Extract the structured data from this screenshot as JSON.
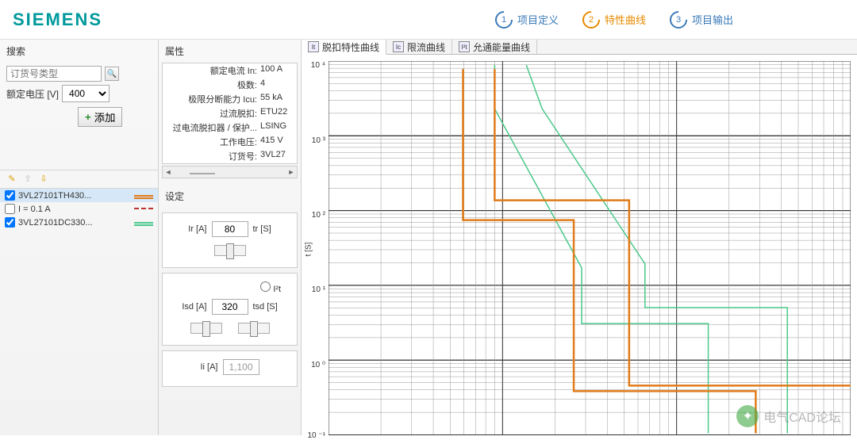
{
  "header": {
    "logo": "SIEMENS",
    "steps": [
      {
        "num": "1",
        "label": "项目定义"
      },
      {
        "num": "2",
        "label": "特性曲线"
      },
      {
        "num": "3",
        "label": "项目输出"
      }
    ],
    "active_step": 1
  },
  "search": {
    "title": "搜索",
    "placeholder": "订货号类型",
    "voltage_label": "额定电压 [V]",
    "voltage_value": "400",
    "add_label": "添加"
  },
  "items": [
    {
      "checked": true,
      "label": "3VL27101TH430...",
      "color": "orange"
    },
    {
      "checked": false,
      "label": "I = 0.1 A",
      "color": "dashed"
    },
    {
      "checked": true,
      "label": "3VL27101DC330...",
      "color": "green"
    }
  ],
  "props": {
    "title": "属性",
    "rows": [
      {
        "k": "额定电流 In:",
        "v": "100 A"
      },
      {
        "k": "极数:",
        "v": "4"
      },
      {
        "k": "极限分断能力 Icu:",
        "v": "55 kA"
      },
      {
        "k": "过流脱扣:",
        "v": "ETU22"
      },
      {
        "k": "过电流脱扣器 / 保护...",
        "v": "LSING"
      },
      {
        "k": "工作电压:",
        "v": "415 V"
      },
      {
        "k": "订货号:",
        "v": "3VL27"
      }
    ]
  },
  "settings": {
    "title": "设定",
    "ir_label": "Ir [A]",
    "ir_value": "80",
    "tr_label": "tr [S]",
    "i2t_label": "I²t",
    "isd_label": "Isd [A]",
    "isd_value": "320",
    "tsd_label": "tsd [S]",
    "ii_label": "Ii [A]",
    "ii_value": "1,100"
  },
  "tabs": [
    {
      "label": "脱扣特性曲线",
      "active": true
    },
    {
      "label": "限流曲线",
      "active": false
    },
    {
      "label": "允通能量曲线",
      "active": false
    }
  ],
  "chart_data": {
    "type": "line",
    "ylabel": "t [S]",
    "y_ticks": [
      "10 ⁴",
      "10 ³",
      "10 ²",
      "10 ¹",
      "10 ⁰",
      "10 ⁻¹"
    ],
    "series": [
      {
        "name": "3VL27101TH430 lower",
        "color": "#e07b1a",
        "points": [
          [
            250,
            7000
          ],
          [
            250,
            150
          ],
          [
            480,
            150
          ],
          [
            480,
            0.4
          ],
          [
            900,
            0.4
          ],
          [
            900,
            0.2
          ]
        ]
      },
      {
        "name": "3VL27101TH430 upper",
        "color": "#e07b1a",
        "points": [
          [
            310,
            7000
          ],
          [
            310,
            230
          ],
          [
            590,
            230
          ],
          [
            590,
            0.5
          ],
          [
            1080,
            0.5
          ],
          [
            1080,
            0.2
          ]
        ]
      },
      {
        "name": "3VL27101DC330 lower",
        "color": "#4ac98a",
        "points": [
          [
            300,
            7000
          ],
          [
            300,
            1000
          ],
          [
            500,
            25
          ],
          [
            500,
            4
          ],
          [
            800,
            4
          ],
          [
            800,
            0.2
          ]
        ]
      },
      {
        "name": "3VL27101DC330 upper",
        "color": "#4ac98a",
        "points": [
          [
            360,
            7000
          ],
          [
            400,
            1000
          ],
          [
            620,
            30
          ],
          [
            620,
            6
          ],
          [
            960,
            6
          ],
          [
            960,
            0.2
          ]
        ]
      }
    ]
  },
  "watermark": "电气CAD论坛"
}
